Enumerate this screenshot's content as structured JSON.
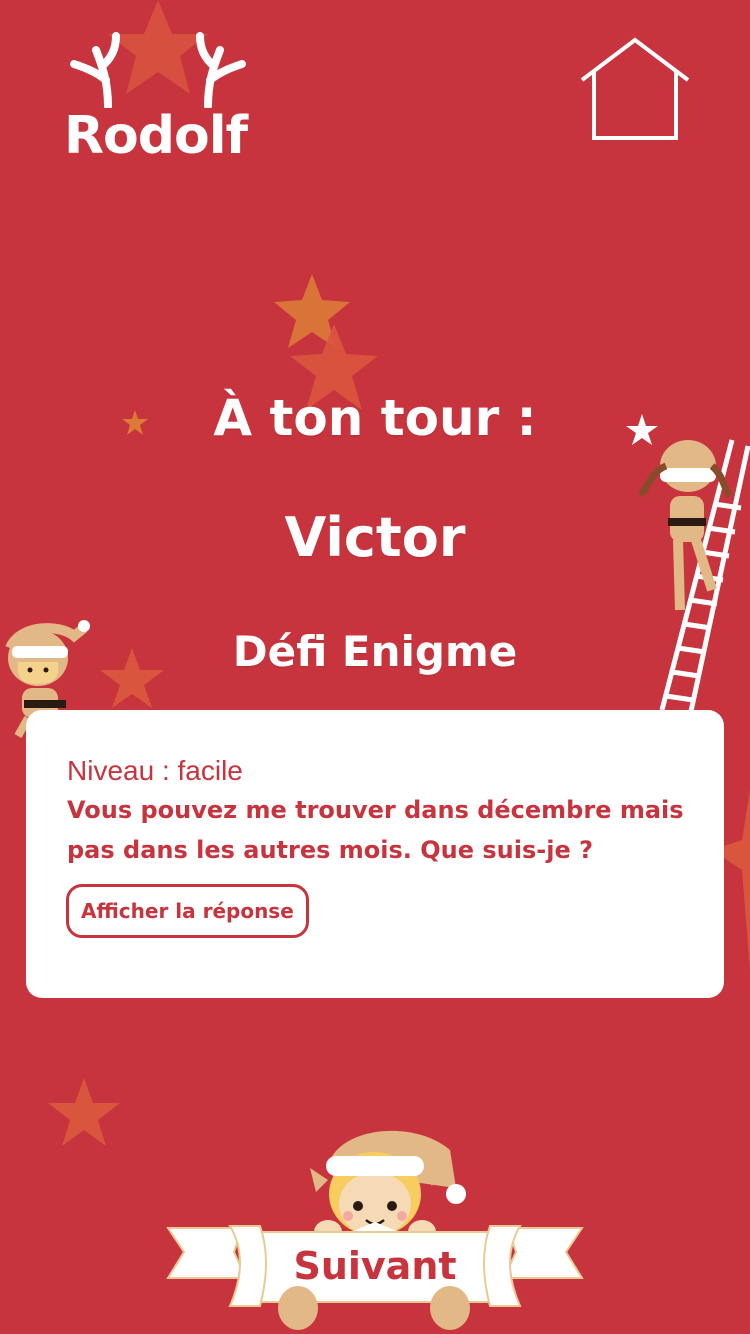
{
  "header": {
    "logo_text": "Rodolf",
    "home_icon": "home-icon"
  },
  "game": {
    "turn_label": "À ton tour :",
    "player_name": "Victor",
    "challenge_title": "Défi Enigme"
  },
  "card": {
    "level": "Niveau : facile",
    "question": "Vous pouvez me trouver dans décembre mais pas dans les autres mois. Que suis-je ?",
    "show_answer_label": "Afficher la réponse"
  },
  "footer": {
    "next_label": "Suivant"
  },
  "colors": {
    "background": "#c8343d",
    "card": "#ffffff",
    "accent": "#c8343d",
    "star": "#d9553e"
  }
}
